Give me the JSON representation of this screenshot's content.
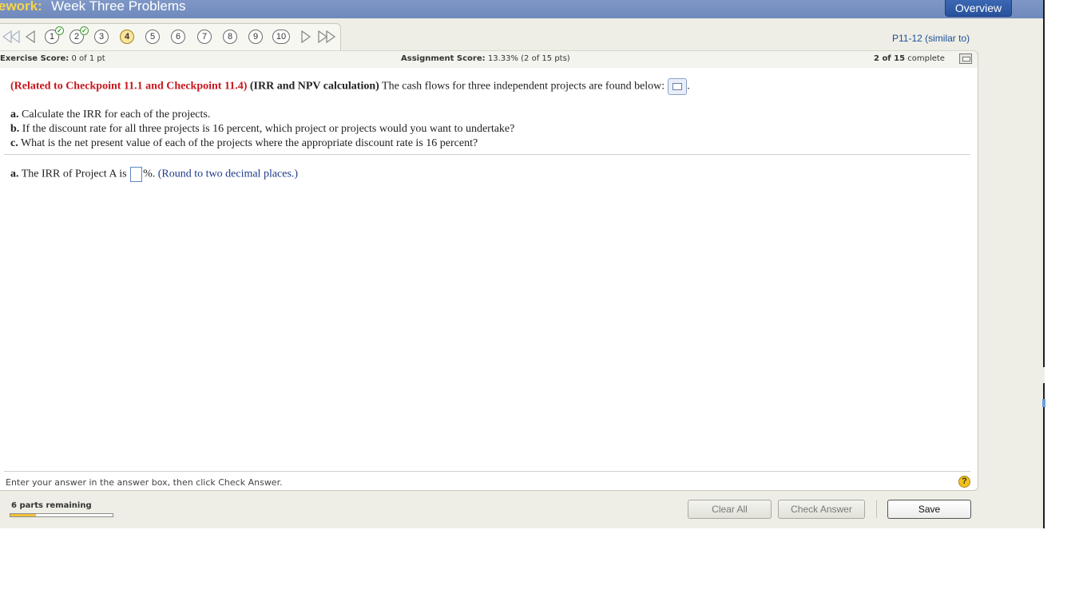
{
  "header": {
    "title_prefix": "ework:",
    "title": "Week Three Problems",
    "overview_label": "Overview"
  },
  "nav": {
    "questions": [
      {
        "label": "1",
        "completed": true
      },
      {
        "label": "2",
        "completed": true
      },
      {
        "label": "3",
        "completed": false
      },
      {
        "label": "4",
        "completed": false,
        "current": true
      },
      {
        "label": "5",
        "completed": false
      },
      {
        "label": "6",
        "completed": false
      },
      {
        "label": "7",
        "completed": false
      },
      {
        "label": "8",
        "completed": false
      },
      {
        "label": "9",
        "completed": false
      },
      {
        "label": "10",
        "completed": false
      }
    ],
    "problem_id": "P11-12 (similar to)"
  },
  "scores": {
    "exercise_label": "Exercise Score:",
    "exercise_value": "0 of 1 pt",
    "assignment_label": "Assignment Score:",
    "assignment_value": "13.33% (2 of 15 pts)",
    "complete_count": "2 of 15",
    "complete_word": "complete"
  },
  "question": {
    "related": "(Related to Checkpoint 11.1 and Checkpoint 11.4)",
    "topic": "(IRR and NPV calculation)",
    "intro": "The cash flows for three independent projects are found below:",
    "intro_end": ".",
    "parts": [
      {
        "letter": "a.",
        "text": "Calculate the IRR for each of the projects."
      },
      {
        "letter": "b.",
        "text": "If the discount rate for all three projects is 16 percent, which project or projects would you want to undertake?"
      },
      {
        "letter": "c.",
        "text": "What is the net present value of each of the projects where the appropriate discount rate is 16 percent?"
      }
    ],
    "answer_letter": "a.",
    "answer_prefix": "The IRR of Project A is",
    "answer_value": "",
    "answer_suffix": "%.",
    "round_note": "(Round to two decimal places.)"
  },
  "footer": {
    "hint": "Enter your answer in the answer box, then click Check Answer.",
    "help": "?",
    "parts_remaining": "6 parts remaining",
    "progress_fraction": 0.25,
    "clear_all": "Clear All",
    "check_answer": "Check Answer",
    "save": "Save"
  },
  "colors": {
    "title_bar": "#7e97c6",
    "title_prefix": "#f6d34a",
    "related_red": "#c8161d",
    "note_blue": "#1f3b8c",
    "current_question": "#fbe59a",
    "progress": "#f0c23a"
  }
}
